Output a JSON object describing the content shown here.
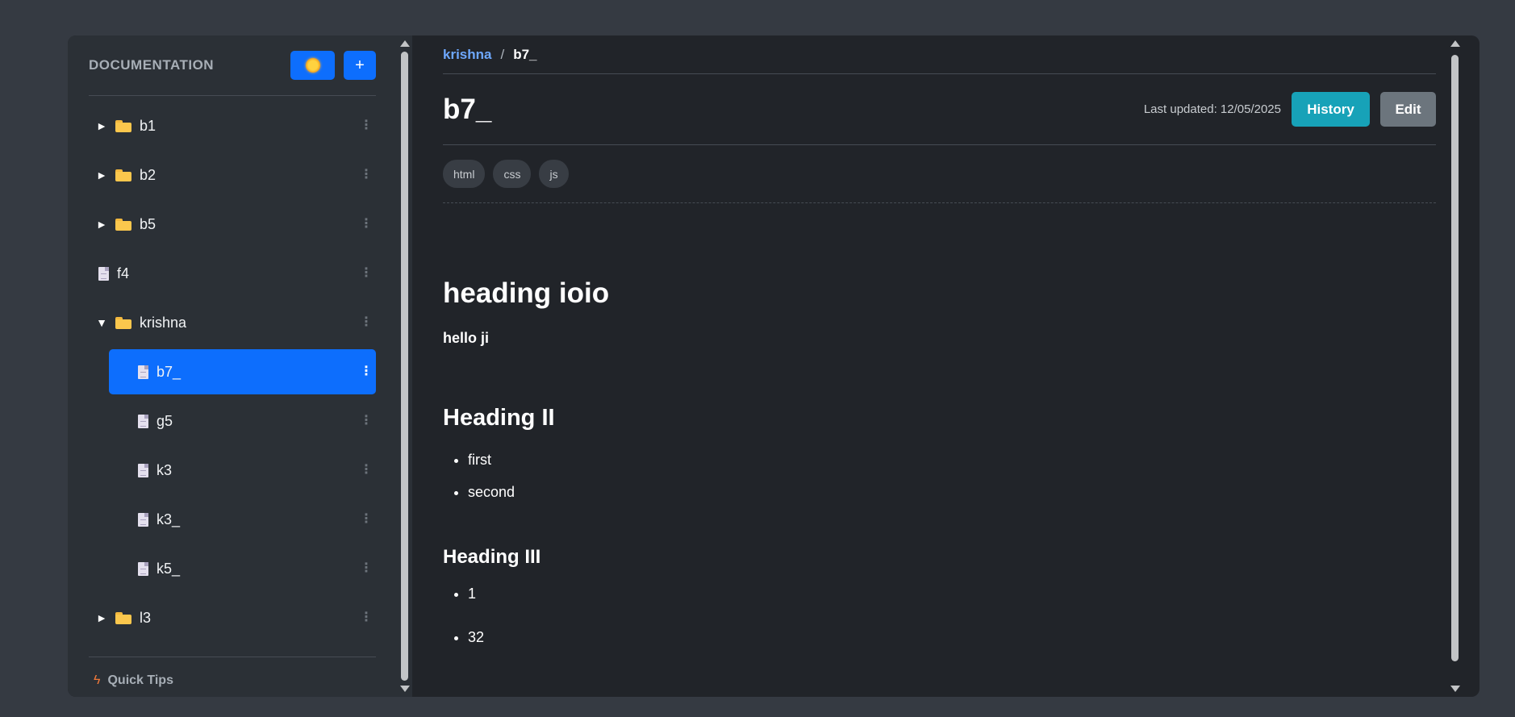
{
  "sidebar": {
    "title": "DOCUMENTATION",
    "add_label": "+",
    "items": [
      {
        "label": "b1",
        "type": "folder",
        "toggle": "►",
        "level": 0
      },
      {
        "label": "b2",
        "type": "folder",
        "toggle": "►",
        "level": 0
      },
      {
        "label": "b5",
        "type": "folder",
        "toggle": "►",
        "level": 0
      },
      {
        "label": "f4",
        "type": "file",
        "toggle": "",
        "level": 0
      },
      {
        "label": "krishna",
        "type": "folder",
        "toggle": "▼",
        "level": 0,
        "expanded": true
      },
      {
        "label": "b7_",
        "type": "file",
        "toggle": "",
        "level": 1,
        "active": true
      },
      {
        "label": "g5",
        "type": "file",
        "toggle": "",
        "level": 1
      },
      {
        "label": "k3",
        "type": "file",
        "toggle": "",
        "level": 1
      },
      {
        "label": "k3_",
        "type": "file",
        "toggle": "",
        "level": 1
      },
      {
        "label": "k5_",
        "type": "file",
        "toggle": "",
        "level": 1
      },
      {
        "label": "l3",
        "type": "folder",
        "toggle": "►",
        "level": 0
      }
    ],
    "footer_label": "Quick Tips",
    "menu_glyph": "⋮"
  },
  "breadcrumb": {
    "parent": "krishna",
    "separator": "/",
    "current": "b7_"
  },
  "page": {
    "title": "b7_",
    "last_updated": "Last updated: 12/05/2025",
    "history_label": "History",
    "edit_label": "Edit",
    "tags": [
      "html",
      "css",
      "js"
    ]
  },
  "document": {
    "heading1": "heading ioio",
    "bold_text": "hello ji",
    "heading2": "Heading II",
    "list1": [
      "first",
      "second"
    ],
    "heading3": "Heading III",
    "list2": [
      "1",
      "32"
    ]
  },
  "colors": {
    "accent": "#0d6efd",
    "history": "#17a2b8",
    "edit": "#6c757d",
    "link": "#6ea8fe"
  }
}
